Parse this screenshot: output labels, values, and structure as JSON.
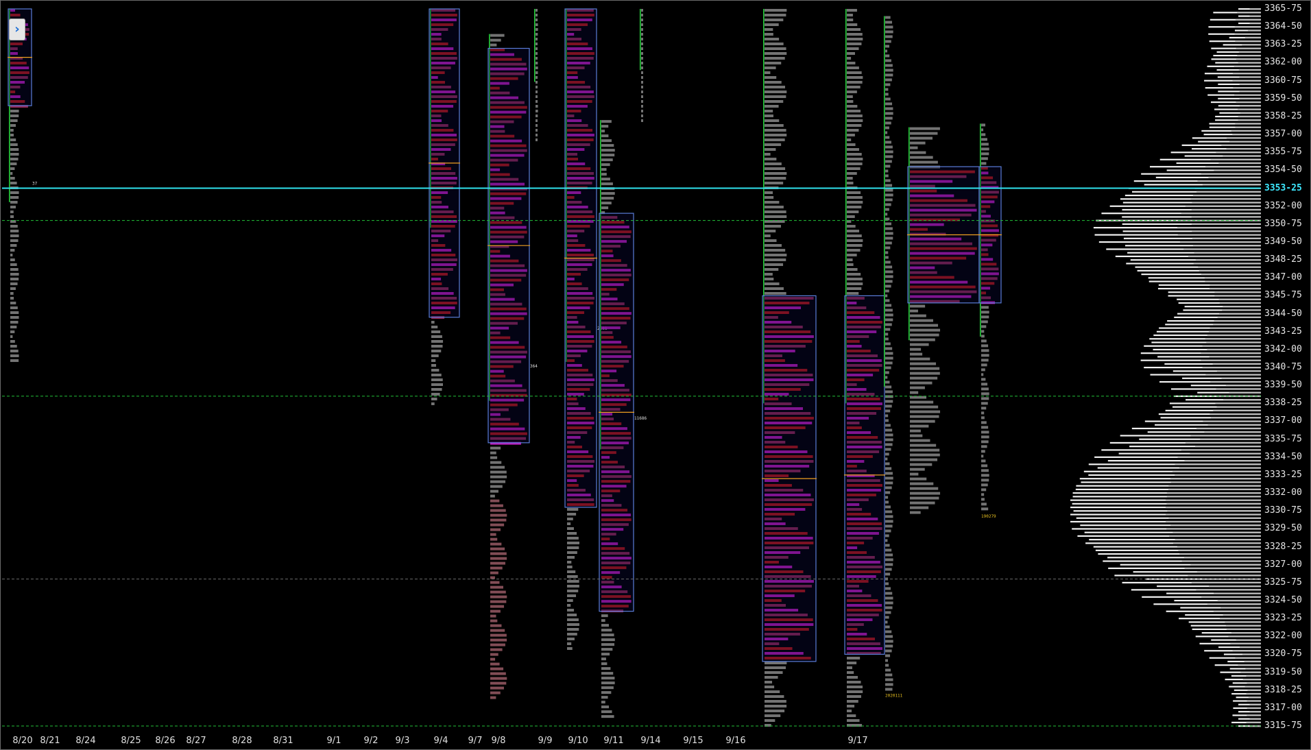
{
  "window": {
    "collapse_label": "›"
  },
  "colors": {
    "background": "#000000",
    "value_area_box": "#5a7dd8",
    "last_price_line": "#2fe3ee",
    "reference_line": "#23c23a",
    "poc_marker": "#f0a020",
    "volume_profile": "#ffffff",
    "tpo_magenta": "#e020e0",
    "tpo_red": "#d81a1a"
  },
  "chart_data": {
    "type": "market-profile",
    "y_axis": {
      "ticks": [
        "3365-75",
        "3364-50",
        "3363-25",
        "3362-00",
        "3360-75",
        "3359-50",
        "3358-25",
        "3357-00",
        "3355-75",
        "3354-50",
        "3353-25",
        "3352-00",
        "3350-75",
        "3349-50",
        "3348-25",
        "3347-00",
        "3345-75",
        "3344-50",
        "3343-25",
        "3342-00",
        "3340-75",
        "3339-50",
        "3338-25",
        "3337-00",
        "3335-75",
        "3334-50",
        "3333-25",
        "3332-00",
        "3330-75",
        "3329-50",
        "3328-25",
        "3327-00",
        "3325-75",
        "3324-50",
        "3323-25",
        "3322-00",
        "3320-75",
        "3319-50",
        "3318-25",
        "3317-00",
        "3315-75"
      ],
      "current_price": "3353-25",
      "range": [
        3315.75,
        3365.75
      ]
    },
    "x_axis": {
      "dates": [
        "8/20",
        "8/21",
        "8/24",
        "8/25",
        "8/26",
        "8/27",
        "8/28",
        "8/31",
        "9/1",
        "9/2",
        "9/3",
        "9/4",
        "9/7",
        "9/8",
        "9/9",
        "9/10",
        "9/11",
        "9/14",
        "9/15",
        "9/16",
        "9/17"
      ]
    },
    "reference_lines": [
      {
        "price": 3353.25,
        "style": "solid",
        "color": "cyan"
      },
      {
        "price": 3351.0,
        "style": "dashed",
        "color": "green"
      },
      {
        "price": 3338.75,
        "style": "dashed",
        "color": "green"
      },
      {
        "price": 3326.0,
        "style": "dashed",
        "color": "gray"
      },
      {
        "price": 3315.75,
        "style": "dashed",
        "color": "green"
      }
    ],
    "profiles": [
      {
        "date": "8/20",
        "high": 3365.75,
        "low": 3341.25,
        "va_high": 3365.75,
        "va_low": 3359.0,
        "label": "37"
      },
      {
        "date": "9/4",
        "high": 3365.75,
        "low": 3338.0,
        "va_high": 3365.75,
        "va_low": 3344.25
      },
      {
        "date": "9/8",
        "high": 3364.0,
        "low": 3317.5,
        "va_high": 3363.0,
        "va_low": 3335.5,
        "label": "364"
      },
      {
        "date": "9/9",
        "high": 3365.75,
        "low": 3356.5
      },
      {
        "date": "9/10",
        "high": 3365.75,
        "low": 3321.0,
        "va_high": 3365.75,
        "va_low": 3331.0,
        "label": "2681"
      },
      {
        "date": "9/11",
        "high": 3358.0,
        "low": 3316.25,
        "va_high": 3351.5,
        "va_low": 3323.75,
        "label": "11686"
      },
      {
        "date": "9/14",
        "high": 3365.75,
        "low": 3358.0
      },
      {
        "date": "9/16",
        "high": 3365.75,
        "low": 3315.75,
        "va_high": 3345.75,
        "va_low": 3320.25
      },
      {
        "date": "9/17",
        "high": 3365.75,
        "low": 3315.75,
        "va_high": 3345.75,
        "va_low": 3320.75
      },
      {
        "date": "9/17",
        "high": 3365.25,
        "low": 3318.25,
        "label": "2020111"
      },
      {
        "date": "9/17",
        "high": 3357.5,
        "low": 3330.5,
        "va_high": 3354.75,
        "va_low": 3345.25
      },
      {
        "date": "9/17",
        "high": 3357.75,
        "low": 3330.75,
        "va_high": 3354.75,
        "va_low": 3345.25,
        "label": "190279"
      }
    ],
    "volume_profile_peak_price": 3331.0
  }
}
